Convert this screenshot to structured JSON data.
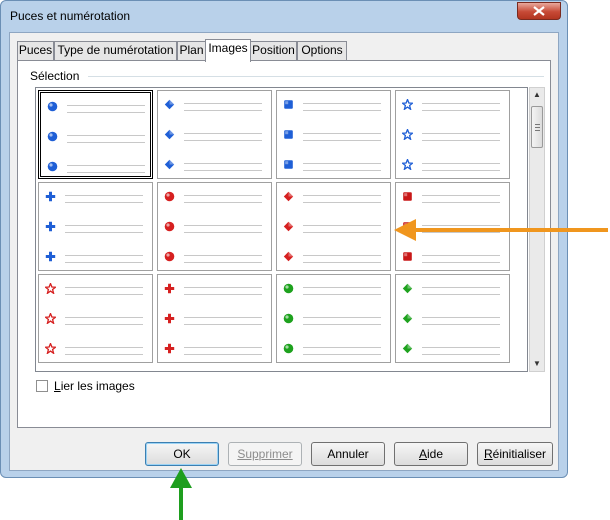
{
  "window": {
    "title": "Puces et numérotation"
  },
  "tabs": [
    {
      "label": "Puces",
      "active": false
    },
    {
      "label": "Type de numérotation",
      "active": false
    },
    {
      "label": "Plan",
      "active": false
    },
    {
      "label": "Images",
      "active": true
    },
    {
      "label": "Position",
      "active": false
    },
    {
      "label": "Options",
      "active": false
    }
  ],
  "selection": {
    "label": "Sélection",
    "cells": [
      {
        "bullet": "sphere",
        "color": "#1f5fd6",
        "selected": true
      },
      {
        "bullet": "diamond",
        "color": "#1f5fd6",
        "selected": false
      },
      {
        "bullet": "cube",
        "color": "#1f5fd6",
        "selected": false
      },
      {
        "bullet": "star",
        "color": "#1f5fd6",
        "selected": false
      },
      {
        "bullet": "cross",
        "color": "#1f5fd6",
        "selected": false
      },
      {
        "bullet": "sphere",
        "color": "#d62020",
        "selected": false
      },
      {
        "bullet": "diamond",
        "color": "#d62020",
        "selected": false
      },
      {
        "bullet": "cube",
        "color": "#c81818",
        "selected": false
      },
      {
        "bullet": "star",
        "color": "#d62020",
        "selected": false
      },
      {
        "bullet": "cross",
        "color": "#d62020",
        "selected": false
      },
      {
        "bullet": "sphere",
        "color": "#1ea21e",
        "selected": false
      },
      {
        "bullet": "diamond",
        "color": "#1ea21e",
        "selected": false
      }
    ]
  },
  "link_images": {
    "label": "Lier les images",
    "underline": "L",
    "rest": "ier les images",
    "checked": false
  },
  "buttons": {
    "ok": "OK",
    "delete": "Supprimer",
    "cancel": "Annuler",
    "help": {
      "u": "A",
      "rest": "ide"
    },
    "reset": {
      "u": "R",
      "rest": "éinitialiser"
    }
  },
  "annotations": {
    "orange_arrow_color": "#f0961e",
    "green_arrow_color": "#1e9e1e"
  }
}
